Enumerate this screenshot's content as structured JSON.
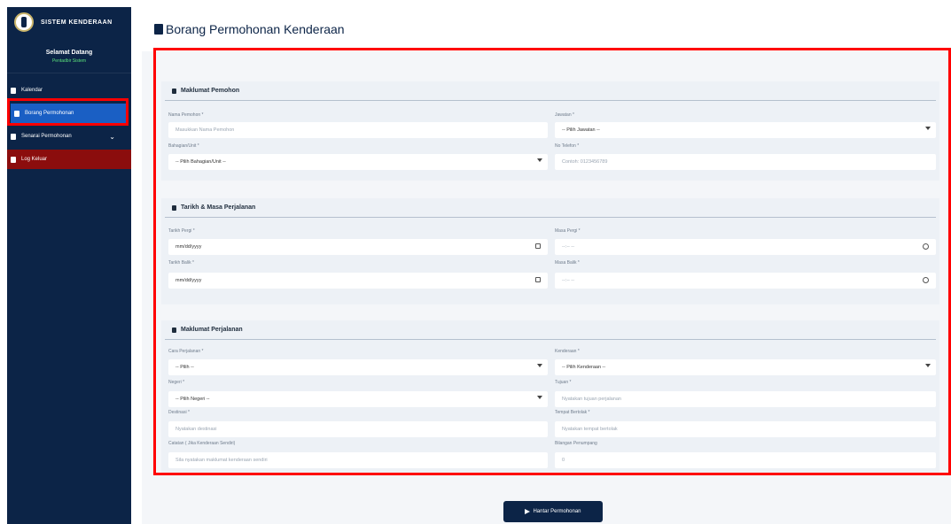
{
  "sidebar": {
    "brand_title": "SISTEM KENDERAAN",
    "user_greeting": "Selamat Datang",
    "user_name": "Pentadbir Sistem",
    "items": [
      {
        "label": "Kalendar"
      },
      {
        "label": "Borang Permohonan"
      },
      {
        "label": "Senarai Permohonan"
      },
      {
        "label": "Log Keluar"
      }
    ]
  },
  "page": {
    "title": "Borang Permohonan Kenderaan"
  },
  "sections": {
    "pemohon": {
      "title": "Maklumat Pemohon",
      "fields": {
        "nama_label": "Nama Pemohon *",
        "nama_placeholder": "Masukkan Nama Pemohon",
        "jawatan_label": "Jawatan *",
        "jawatan_value": "-- Pilih Jawatan --",
        "bahagian_label": "Bahagian/Unit *",
        "bahagian_value": "-- Pilih Bahagian/Unit --",
        "telefon_label": "No Telefon *",
        "telefon_placeholder": "Contoh: 0123456789"
      }
    },
    "tarikh": {
      "title": "Tarikh & Masa Perjalanan",
      "fields": {
        "tarikh_pergi_label": "Tarikh Pergi *",
        "tarikh_pergi_value": "mm/dd/yyyy",
        "masa_pergi_label": "Masa Pergi *",
        "masa_pergi_value": "--:-- --",
        "tarikh_balik_label": "Tarikh Balik *",
        "tarikh_balik_value": "mm/dd/yyyy",
        "masa_balik_label": "Masa Balik *",
        "masa_balik_value": "--:-- --"
      }
    },
    "perjalanan": {
      "title": "Maklumat Perjalanan",
      "fields": {
        "cara_label": "Cara Perjalanan *",
        "cara_value": "-- Pilih --",
        "kenderaan_label": "Kenderaan *",
        "kenderaan_value": "-- Pilih Kenderaan --",
        "negeri_label": "Negeri *",
        "negeri_value": "-- Pilih Negeri --",
        "tujuan_label": "Tujuan *",
        "tujuan_placeholder": "Nyatakan tujuan perjalanan",
        "destinasi_label": "Destinasi *",
        "destinasi_placeholder": "Nyatakan destinasi",
        "tempat_label": "Tempat Bertolak *",
        "tempat_placeholder": "Nyatakan tempat bertolak",
        "catatan_label": "Catatan ( Jika Kenderaan Sendiri)",
        "catatan_placeholder": "Sila nyatakan maklumat kenderaan sendiri",
        "bilangan_label": "Bilangan Penumpang",
        "bilangan_placeholder": "0"
      }
    }
  },
  "submit_label": "Hantar Permohonan",
  "colors": {
    "sidebar_bg": "#0c2447",
    "active_item": "#1a5fc4",
    "logout_item": "#8b0d0d",
    "highlight_border": "#ff0000"
  }
}
